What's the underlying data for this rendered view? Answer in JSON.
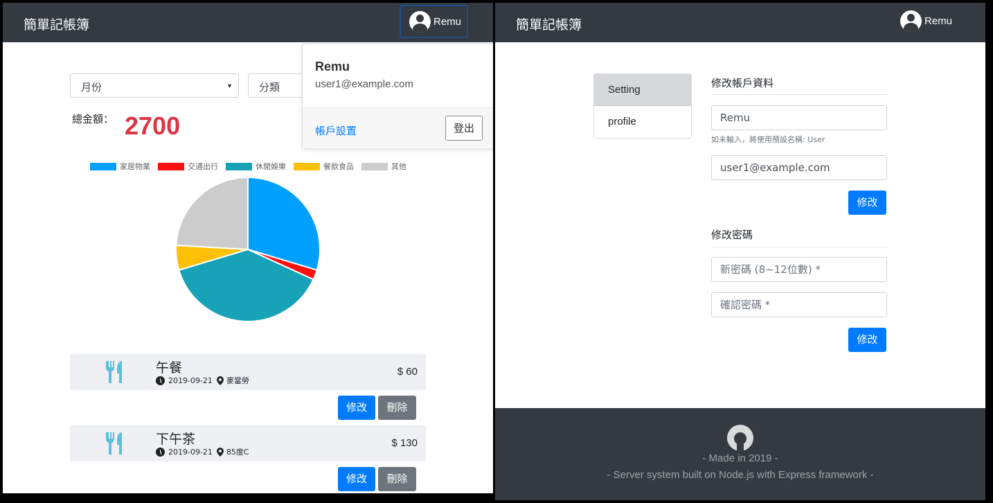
{
  "app": {
    "brand": "簡單記帳簿",
    "user_name": "Remu"
  },
  "main": {
    "month_select": "月份",
    "category_select": "分類",
    "total_label": "總金額：",
    "total_amount": "2700"
  },
  "chart_data": {
    "type": "pie",
    "legend_position": "top",
    "categories": [
      "家居物業",
      "交通出行",
      "休閒娛樂",
      "餐飲食品",
      "其他"
    ],
    "colors": [
      "#00a0ff",
      "#ff1010",
      "#17a2b8",
      "#ffc107",
      "#cccccc"
    ],
    "values": [
      800,
      60,
      1040,
      150,
      650
    ]
  },
  "records": [
    {
      "title": "午餐",
      "date": "2019-09-21",
      "location": "麥當勞",
      "amount": "$ 60",
      "edit": "修改",
      "delete": "刪除"
    },
    {
      "title": "下午茶",
      "date": "2019-09-21",
      "location": "85度C",
      "amount": "$ 130",
      "edit": "修改",
      "delete": "刪除"
    }
  ],
  "dropdown": {
    "name": "Remu",
    "email": "user1@example.com",
    "settings_link": "帳戶設置",
    "logout": "登出"
  },
  "settings": {
    "nav": [
      "Setting",
      "profile"
    ],
    "profile_title": "修改帳戶資料",
    "name_value": "Remu",
    "name_hint": "如未輸入，將使用預設名稱: User",
    "email_value": "user1@example.com",
    "submit_profile": "修改",
    "password_title": "修改密碼",
    "new_password_placeholder": "新密碼 (8~12位數) *",
    "confirm_password_placeholder": "確認密碼 *",
    "submit_password": "修改"
  },
  "footer": {
    "made_in": "- Made in 2019 -",
    "built_with": "- Server system built on Node.js with Express framework -"
  }
}
